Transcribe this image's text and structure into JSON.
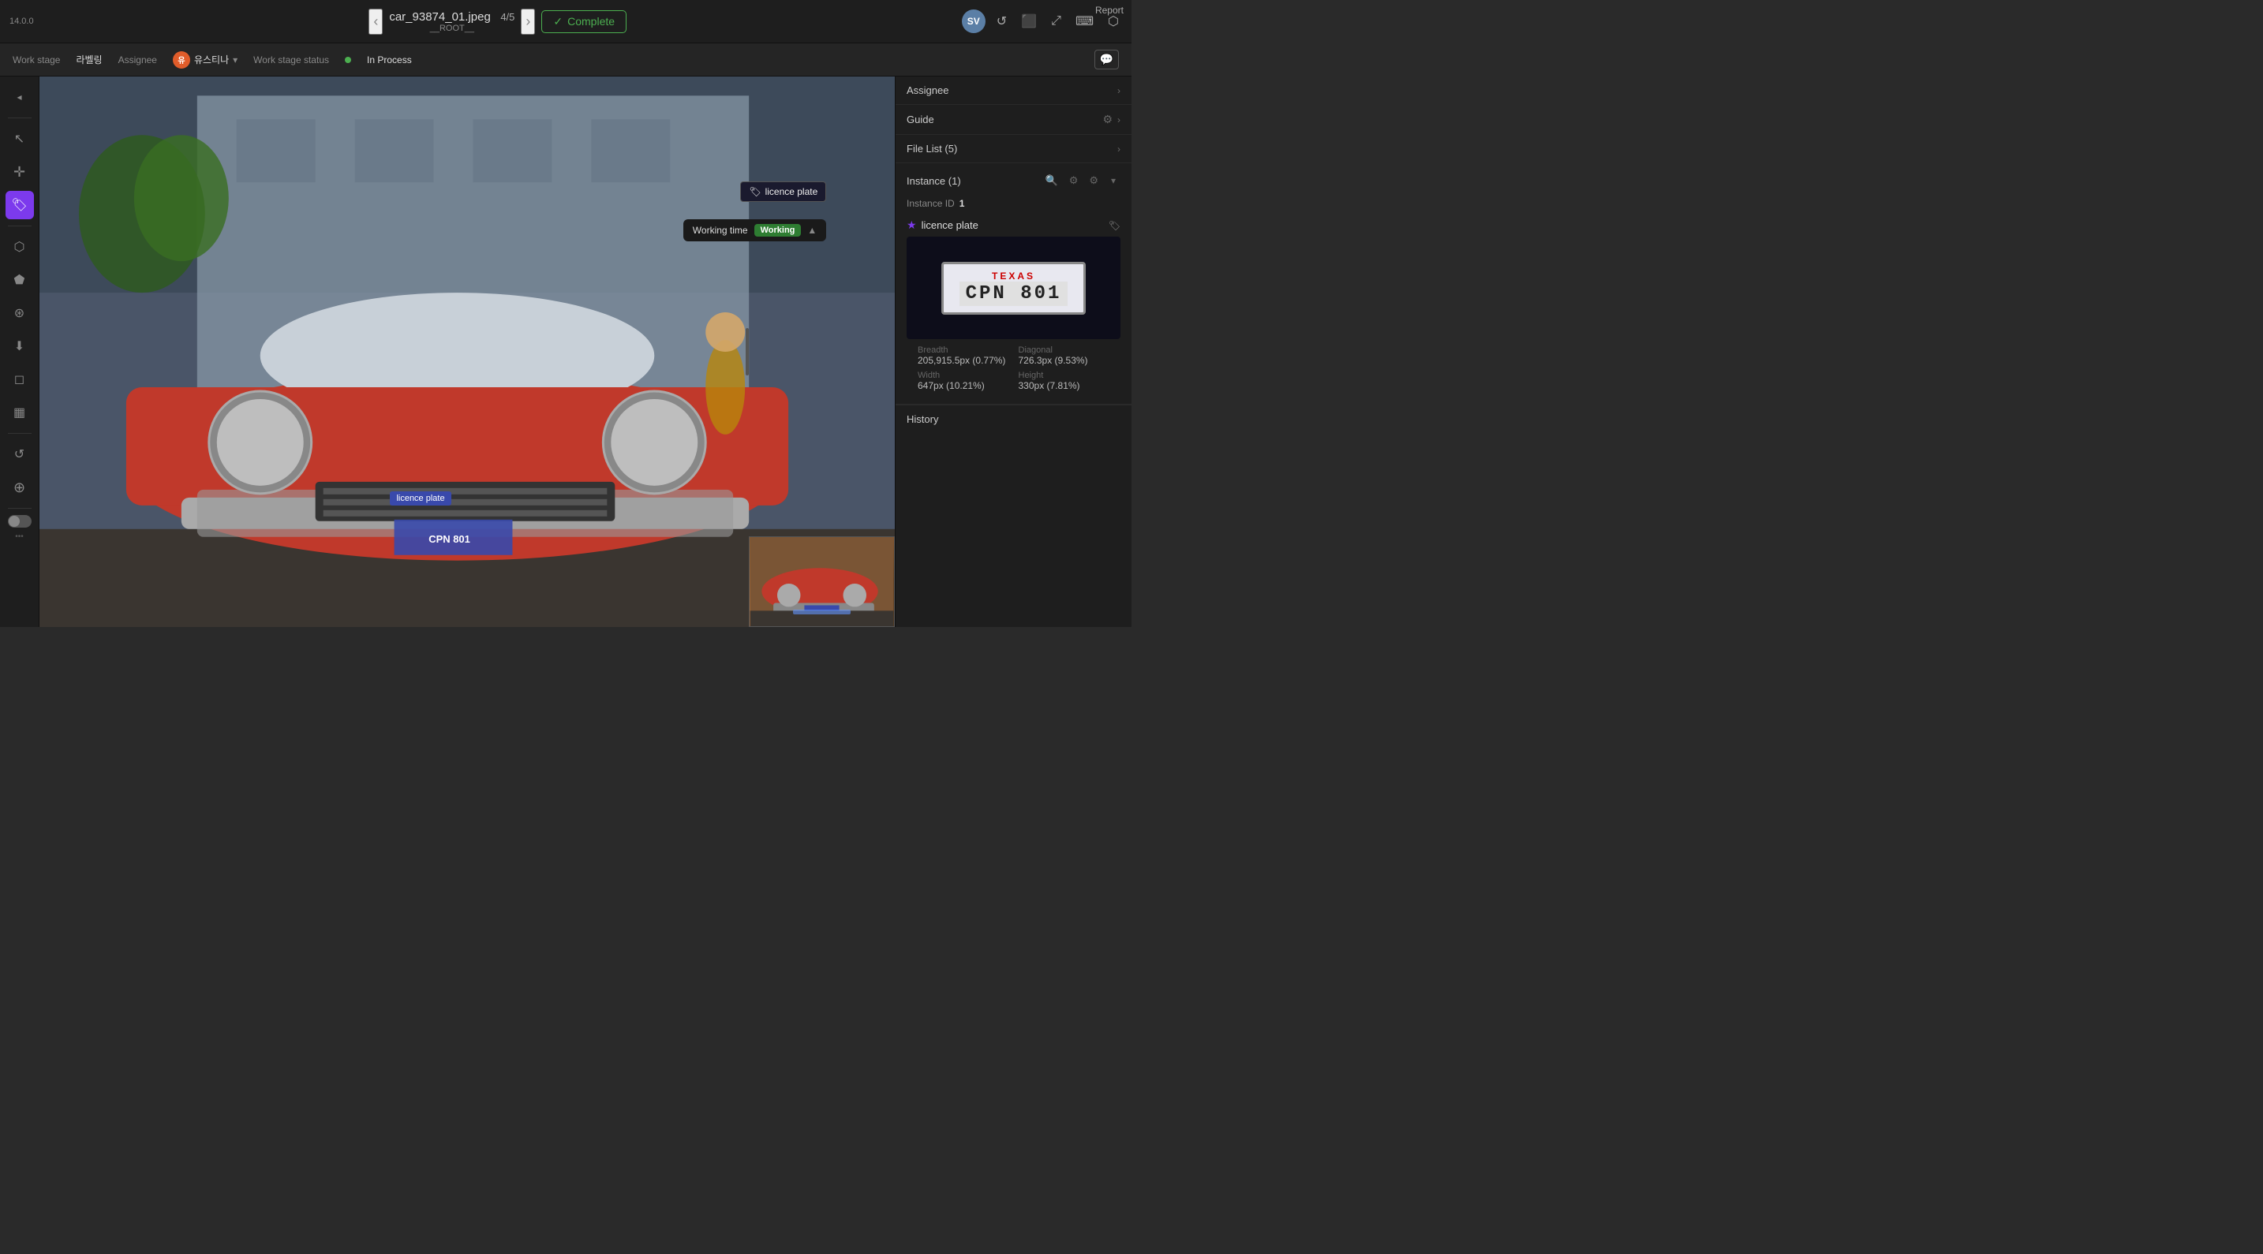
{
  "app": {
    "version": "14.0.0",
    "report_label": "Report"
  },
  "topbar": {
    "filename": "car_93874_01.jpeg",
    "current_index": "4",
    "total": "/5",
    "root": "__ROOT__",
    "complete_label": "Complete",
    "avatar_initials": "SV"
  },
  "secondarybar": {
    "work_stage_label": "Work stage",
    "work_stage_value": "라벨링",
    "assignee_label": "Assignee",
    "assignee_initials": "유",
    "assignee_name": "유스티나",
    "status_label": "Work stage status",
    "status_value": "In Process"
  },
  "canvas": {
    "label_text": "licence plate",
    "working_time_label": "Working time",
    "working_status": "Working",
    "bbox_label": "licence plate"
  },
  "right_panel": {
    "assignee_section": "Assignee",
    "guide_section": "Guide",
    "file_list_section": "File List (5)",
    "instance_section": "Instance (1)",
    "instance_id_label": "Instance ID",
    "instance_id_value": "1",
    "instance_name": "licence plate",
    "breadth_label": "Breadth",
    "breadth_value": "205,915.5px (0.77%)",
    "diagonal_label": "Diagonal",
    "diagonal_value": "726.3px (9.53%)",
    "width_label": "Width",
    "width_value": "647px (10.21%)",
    "height_label": "Height",
    "height_value": "330px (7.81%)",
    "history_label": "History",
    "plate_state": "TEXAS",
    "plate_number": "CPN  801"
  },
  "toolbar": {
    "items": [
      {
        "name": "cursor-tool",
        "icon": "↖",
        "active": false
      },
      {
        "name": "move-tool",
        "icon": "+",
        "active": false
      },
      {
        "name": "tag-tool",
        "icon": "⊕",
        "active": true
      },
      {
        "name": "polygon-tool",
        "icon": "⬡",
        "active": false
      },
      {
        "name": "shape-tool",
        "icon": "⬟",
        "active": false
      },
      {
        "name": "node-tool",
        "icon": "⊛",
        "active": false
      },
      {
        "name": "download-tool",
        "icon": "⬇",
        "active": false
      },
      {
        "name": "erase-tool",
        "icon": "⊘",
        "active": false
      },
      {
        "name": "grid-tool",
        "icon": "▦",
        "active": false
      },
      {
        "name": "undo-tool",
        "icon": "↺",
        "active": false
      },
      {
        "name": "zoom-tool",
        "icon": "⊕",
        "active": false
      }
    ]
  }
}
